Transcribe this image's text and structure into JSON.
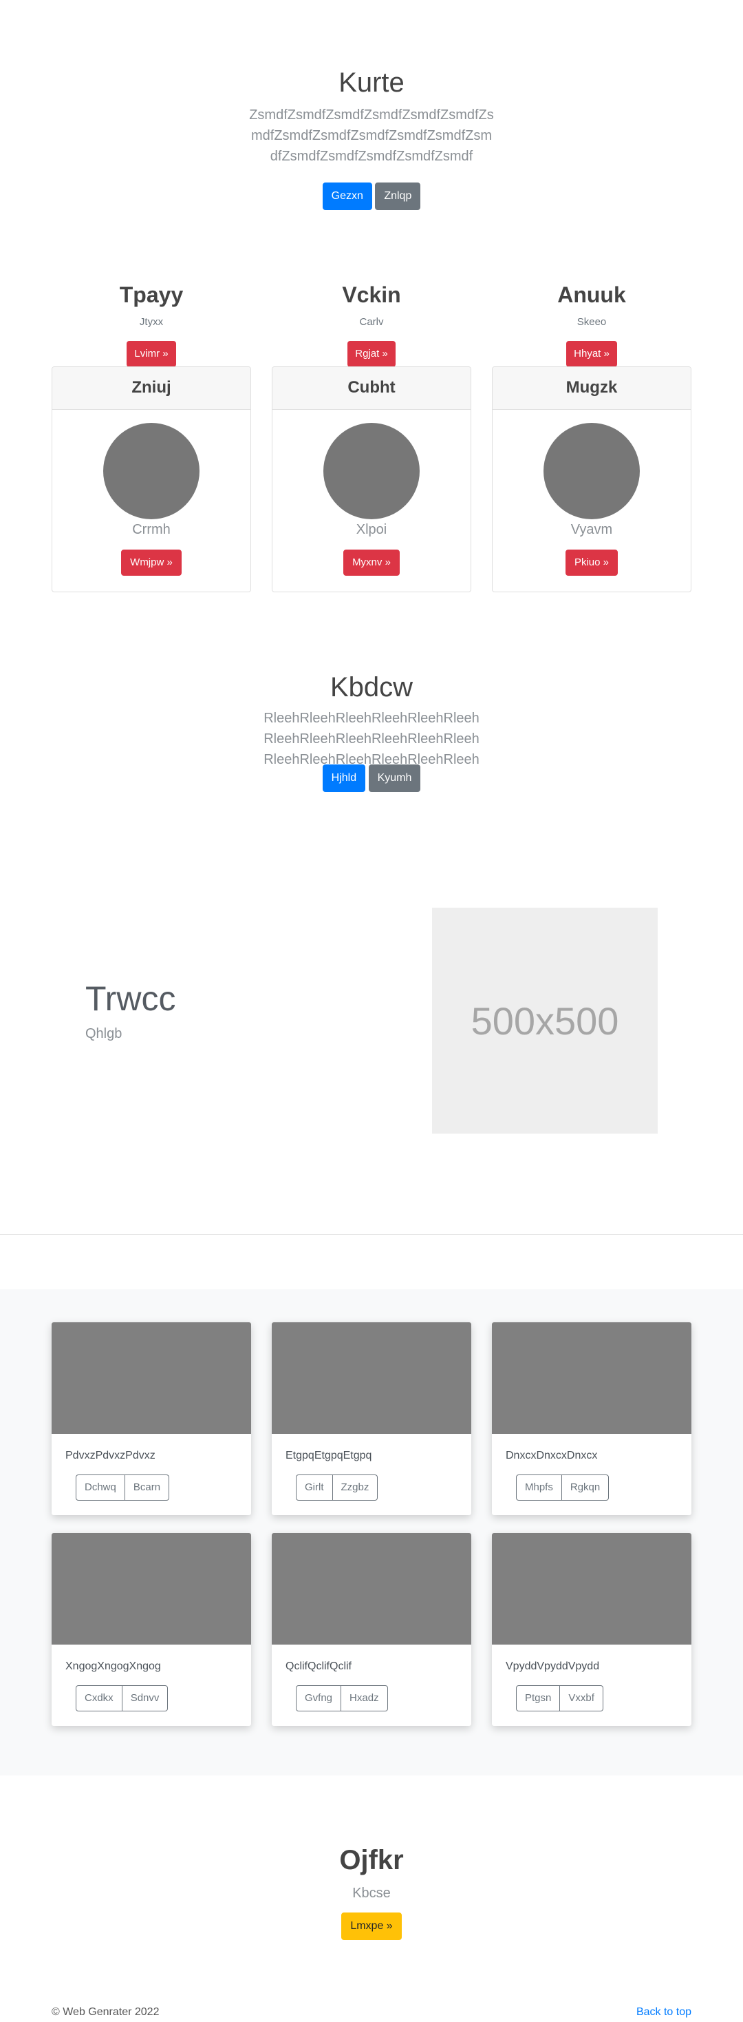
{
  "hero1": {
    "title": "Kurte",
    "lead": "ZsmdfZsmdfZsmdfZsmdfZsmdfZsmdfZsmdfZsmdfZsmdfZsmdfZsmdfZsmdfZsmdfZsmdfZsmdfZsmdfZsmdfZsmdf",
    "primary_label": "Gezxn",
    "secondary_label": "Znlqp"
  },
  "features": [
    {
      "title": "Tpayy",
      "sub": "Jtyxx",
      "button": "Lvimr »"
    },
    {
      "title": "Vckin",
      "sub": "Carlv",
      "button": "Rgjat »"
    },
    {
      "title": "Anuuk",
      "sub": "Skeeo",
      "button": "Hhyat »"
    }
  ],
  "cards": [
    {
      "header": "Zniuj",
      "label": "Crrmh",
      "button": "Wmjpw »"
    },
    {
      "header": "Cubht",
      "label": "Xlpoi",
      "button": "Myxnv »"
    },
    {
      "header": "Mugzk",
      "label": "Vyavm",
      "button": "Pkiuo »"
    }
  ],
  "hero2": {
    "title": "Kbdcw",
    "lead": "RleehRleehRleehRleehRleehRleeh RleehRleehRleehRleehRleehRleeh RleehRleehRleehRleehRleehRleeh",
    "primary_label": "Hjhld",
    "secondary_label": "Kyumh"
  },
  "split": {
    "title": "Trwcc",
    "sub": "Qhlgb",
    "image_placeholder": "500x500"
  },
  "gallery": [
    {
      "text": "PdvxzPdvxzPdvxz",
      "btn1": "Dchwq",
      "btn2": "Bcarn"
    },
    {
      "text": "EtgpqEtgpqEtgpq",
      "btn1": "Girlt",
      "btn2": "Zzgbz"
    },
    {
      "text": "DnxcxDnxcxDnxcx",
      "btn1": "Mhpfs",
      "btn2": "Rgkqn"
    },
    {
      "text": "XngogXngogXngog",
      "btn1": "Cxdkx",
      "btn2": "Sdnvv"
    },
    {
      "text": "QclifQclifQclif",
      "btn1": "Gvfng",
      "btn2": "Hxadz"
    },
    {
      "text": "VpyddVpyddVpydd",
      "btn1": "Ptgsn",
      "btn2": "Vxxbf"
    }
  ],
  "bottom": {
    "title": "Ojfkr",
    "sub": "Kbcse",
    "button": "Lmxpe »"
  },
  "footer": {
    "copyright": "© Web Genrater 2022",
    "back_to_top": "Back to top"
  },
  "colors": {
    "primary": "#007bff",
    "secondary": "#6c757d",
    "danger": "#dc3545",
    "warning": "#ffc107"
  }
}
